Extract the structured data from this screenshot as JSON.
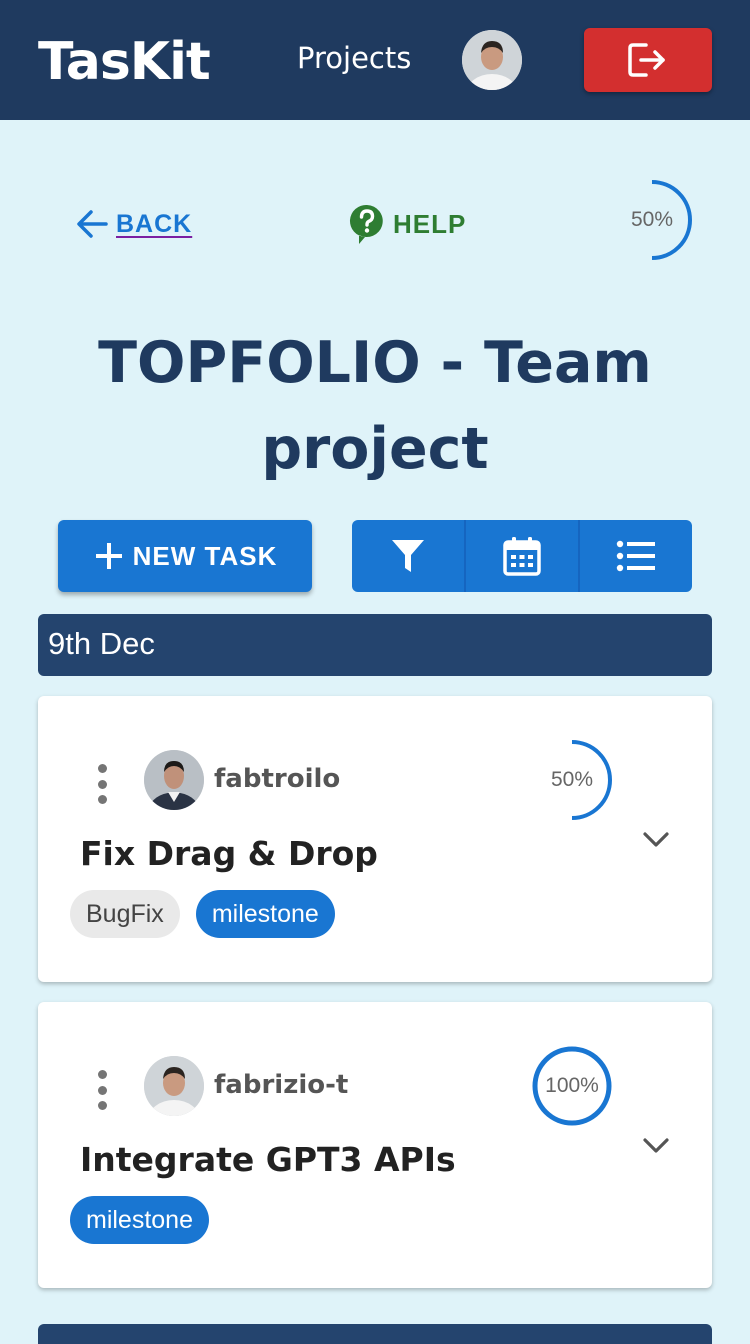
{
  "header": {
    "logo": "TasKit",
    "nav_projects": "Projects",
    "colors": {
      "bar": "#1f3a5f",
      "logout": "#d32f2f"
    }
  },
  "controls": {
    "back_label": "BACK",
    "help_label": "HELP",
    "project_progress_label": "50%",
    "project_progress_value": 0.5
  },
  "project": {
    "title": "TOPFOLIO - Team project"
  },
  "toolbar": {
    "new_task_label": "NEW TASK"
  },
  "date_group": {
    "label": "9th Dec"
  },
  "tasks": [
    {
      "username": "fabtroilo",
      "title": "Fix Drag & Drop",
      "progress_label": "50%",
      "progress_value": 0.5,
      "tags": [
        "BugFix",
        "milestone"
      ]
    },
    {
      "username": "fabrizio-t",
      "title": "Integrate GPT3 APIs",
      "progress_label": "100%",
      "progress_value": 1.0,
      "tags": [
        "milestone"
      ]
    }
  ],
  "colors": {
    "background": "#dff3f9",
    "primary": "#1976d2",
    "navy": "#1f3a5f",
    "help_green": "#2e7d32"
  }
}
